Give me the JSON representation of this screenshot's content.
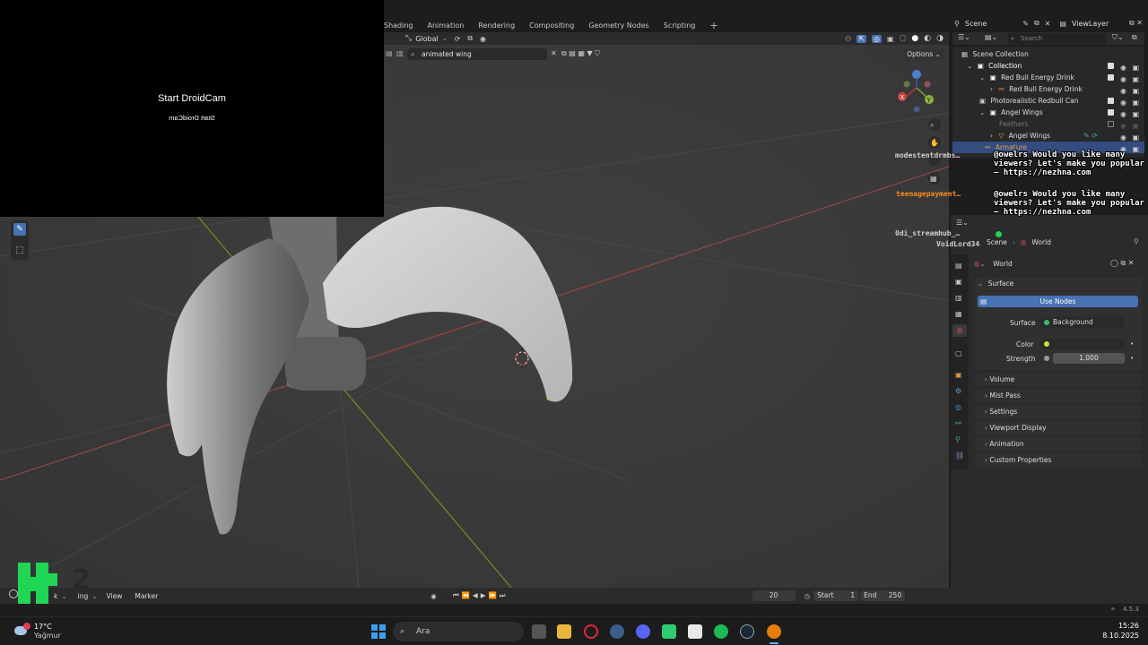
{
  "workspace_tabs": [
    "Shading",
    "Animation",
    "Rendering",
    "Compositing",
    "Geometry Nodes",
    "Scripting"
  ],
  "viewport": {
    "orientation": "Global",
    "search_value": "animated wing",
    "options_label": "Options"
  },
  "droidcam": {
    "title": "Start DroidCam",
    "mirrored": "Start DroidCam"
  },
  "scene_bar": {
    "scene": "Scene",
    "view_layer": "ViewLayer",
    "search_placeholder": "Search"
  },
  "outliner": {
    "rows": [
      {
        "label": "Scene Collection"
      },
      {
        "label": "Collection"
      },
      {
        "label": "Red Bull Energy Drink"
      },
      {
        "label": "Red Bull Energy Drink"
      },
      {
        "label": "Photorealistic Redbull Can"
      },
      {
        "label": "Angel Wings"
      },
      {
        "label": "Feathers"
      },
      {
        "label": "Angel Wings"
      },
      {
        "label": "Armature"
      }
    ]
  },
  "chat": {
    "names": [
      {
        "name": "modestentdrmbs…",
        "color": "#e0e0e0"
      },
      {
        "name": "teenagepayment…",
        "color": "#ff8c1a"
      },
      {
        "name": "0di_streamhub_…",
        "color": "#e0e0e0"
      },
      {
        "name": "VoidLord34",
        "color": "#e0e0e0"
      }
    ],
    "messages": [
      "@owelrs Would you like many viewers? Let's make you popular — https://nezhna.com",
      "@owelrs Would you like many viewers? Let's make you popular — https://nezhna.com"
    ]
  },
  "properties": {
    "breadcrumb_scene": "Scene",
    "breadcrumb_world": "World",
    "world_name": "World",
    "surface_panel": "Surface",
    "use_nodes": "Use Nodes",
    "surface_label": "Surface",
    "surface_value": "Background",
    "color_label": "Color",
    "strength_label": "Strength",
    "strength_value": "1.000",
    "panels": [
      "Volume",
      "Mist Pass",
      "Settings",
      "Viewport Display",
      "Animation",
      "Custom Properties"
    ]
  },
  "timeline": {
    "playback": "k",
    "keying": "ing",
    "view": "View",
    "marker": "Marker",
    "current_frame": "20",
    "start_label": "Start",
    "start_value": "1",
    "end_label": "End",
    "end_value": "250"
  },
  "status": {
    "version": "4.5.3"
  },
  "taskbar": {
    "temperature": "17°C",
    "weather": "Yağmur",
    "search_placeholder": "Ara",
    "time": "15:26",
    "date": "8.10.2025"
  },
  "colors": {
    "accent": "#4772b3",
    "selection": "#334d80",
    "x_axis": "#b34a4a",
    "y_axis": "#7ea02a",
    "overlay_green": "#1fd655"
  }
}
